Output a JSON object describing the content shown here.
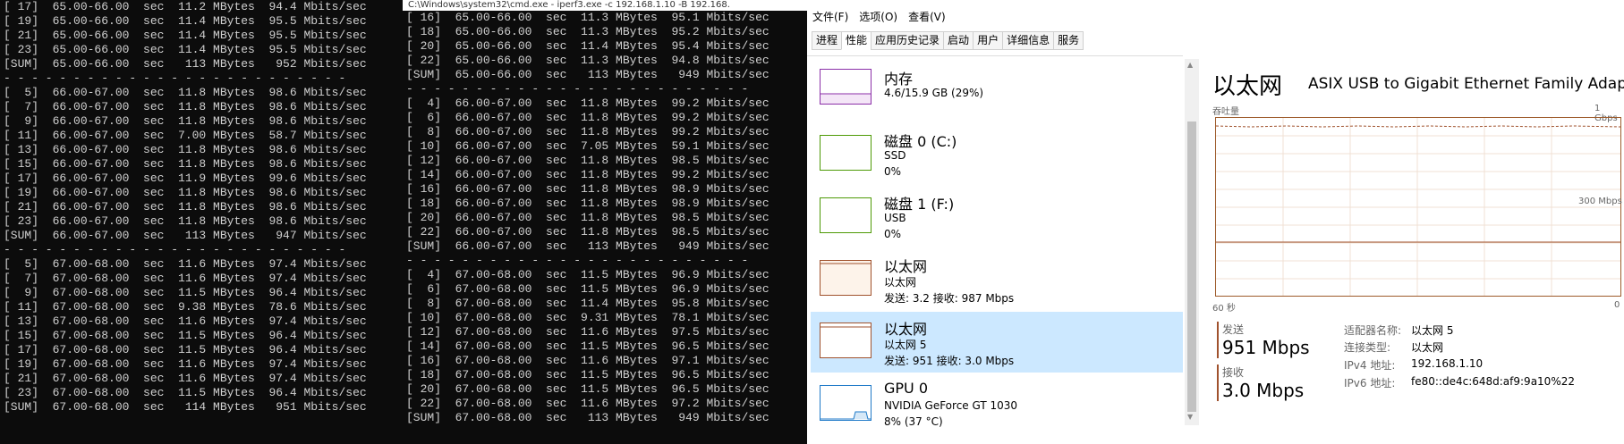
{
  "cmd1": {
    "lines": [
      "[ 17]  65.00-66.00  sec  11.2 MBytes  94.4 Mbits/sec",
      "[ 19]  65.00-66.00  sec  11.4 MBytes  95.5 Mbits/sec",
      "[ 21]  65.00-66.00  sec  11.4 MBytes  95.5 Mbits/sec",
      "[ 23]  65.00-66.00  sec  11.4 MBytes  95.5 Mbits/sec",
      "[SUM]  65.00-66.00  sec   113 MBytes   952 Mbits/sec",
      "- - - - - - - - - - - - - - - - - - - - - - - - -",
      "[  5]  66.00-67.00  sec  11.8 MBytes  98.6 Mbits/sec",
      "[  7]  66.00-67.00  sec  11.8 MBytes  98.6 Mbits/sec",
      "[  9]  66.00-67.00  sec  11.8 MBytes  98.6 Mbits/sec",
      "[ 11]  66.00-67.00  sec  7.00 MBytes  58.7 Mbits/sec",
      "[ 13]  66.00-67.00  sec  11.8 MBytes  98.6 Mbits/sec",
      "[ 15]  66.00-67.00  sec  11.8 MBytes  98.6 Mbits/sec",
      "[ 17]  66.00-67.00  sec  11.9 MBytes  99.6 Mbits/sec",
      "[ 19]  66.00-67.00  sec  11.8 MBytes  98.6 Mbits/sec",
      "[ 21]  66.00-67.00  sec  11.8 MBytes  98.6 Mbits/sec",
      "[ 23]  66.00-67.00  sec  11.8 MBytes  98.6 Mbits/sec",
      "[SUM]  66.00-67.00  sec   113 MBytes   947 Mbits/sec",
      "- - - - - - - - - - - - - - - - - - - - - - - - -",
      "[  5]  67.00-68.00  sec  11.6 MBytes  97.4 Mbits/sec",
      "[  7]  67.00-68.00  sec  11.6 MBytes  97.4 Mbits/sec",
      "[  9]  67.00-68.00  sec  11.5 MBytes  96.4 Mbits/sec",
      "[ 11]  67.00-68.00  sec  9.38 MBytes  78.6 Mbits/sec",
      "[ 13]  67.00-68.00  sec  11.6 MBytes  97.4 Mbits/sec",
      "[ 15]  67.00-68.00  sec  11.5 MBytes  96.4 Mbits/sec",
      "[ 17]  67.00-68.00  sec  11.5 MBytes  96.4 Mbits/sec",
      "[ 19]  67.00-68.00  sec  11.6 MBytes  97.4 Mbits/sec",
      "[ 21]  67.00-68.00  sec  11.6 MBytes  97.4 Mbits/sec",
      "[ 23]  67.00-68.00  sec  11.5 MBytes  96.4 Mbits/sec",
      "[SUM]  67.00-68.00  sec   114 MBytes   951 Mbits/sec"
    ]
  },
  "cmd2": {
    "title": "C:\\Windows\\system32\\cmd.exe - iperf3.exe  -c 192.168.1.10 -B 192.168.",
    "lines": [
      "[ 16]  65.00-66.00  sec  11.3 MBytes  95.1 Mbits/sec",
      "[ 18]  65.00-66.00  sec  11.3 MBytes  95.2 Mbits/sec",
      "[ 20]  65.00-66.00  sec  11.4 MBytes  95.4 Mbits/sec",
      "[ 22]  65.00-66.00  sec  11.3 MBytes  94.8 Mbits/sec",
      "[SUM]  65.00-66.00  sec   113 MBytes   949 Mbits/sec",
      "- - - - - - - - - - - - - - - - - - - - - - - - -",
      "[  4]  66.00-67.00  sec  11.8 MBytes  99.2 Mbits/sec",
      "[  6]  66.00-67.00  sec  11.8 MBytes  99.2 Mbits/sec",
      "[  8]  66.00-67.00  sec  11.8 MBytes  99.2 Mbits/sec",
      "[ 10]  66.00-67.00  sec  7.05 MBytes  59.1 Mbits/sec",
      "[ 12]  66.00-67.00  sec  11.8 MBytes  98.5 Mbits/sec",
      "[ 14]  66.00-67.00  sec  11.8 MBytes  99.2 Mbits/sec",
      "[ 16]  66.00-67.00  sec  11.8 MBytes  98.9 Mbits/sec",
      "[ 18]  66.00-67.00  sec  11.8 MBytes  98.9 Mbits/sec",
      "[ 20]  66.00-67.00  sec  11.8 MBytes  98.5 Mbits/sec",
      "[ 22]  66.00-67.00  sec  11.8 MBytes  98.5 Mbits/sec",
      "[SUM]  66.00-67.00  sec   113 MBytes   949 Mbits/sec",
      "- - - - - - - - - - - - - - - - - - - - - - - - -",
      "[  4]  67.00-68.00  sec  11.5 MBytes  96.9 Mbits/sec",
      "[  6]  67.00-68.00  sec  11.5 MBytes  96.9 Mbits/sec",
      "[  8]  67.00-68.00  sec  11.4 MBytes  95.8 Mbits/sec",
      "[ 10]  67.00-68.00  sec  9.31 MBytes  78.1 Mbits/sec",
      "[ 12]  67.00-68.00  sec  11.6 MBytes  97.5 Mbits/sec",
      "[ 14]  67.00-68.00  sec  11.5 MBytes  96.5 Mbits/sec",
      "[ 16]  67.00-68.00  sec  11.6 MBytes  97.1 Mbits/sec",
      "[ 18]  67.00-68.00  sec  11.5 MBytes  96.5 Mbits/sec",
      "[ 20]  67.00-68.00  sec  11.5 MBytes  96.5 Mbits/sec",
      "[ 22]  67.00-68.00  sec  11.6 MBytes  97.2 Mbits/sec",
      "[SUM]  67.00-68.00  sec   113 MBytes   949 Mbits/sec"
    ]
  },
  "taskmgr": {
    "menu": [
      "文件(F)",
      "选项(O)",
      "查看(V)"
    ],
    "tabs": [
      "进程",
      "性能",
      "应用历史记录",
      "启动",
      "用户",
      "详细信息",
      "服务"
    ],
    "active_tab": 1,
    "items": [
      {
        "name": "内存",
        "sub": "4.6/15.9 GB (29%)",
        "val": "",
        "color": "#8b2fa8"
      },
      {
        "name": "磁盘 0 (C:)",
        "sub": "SSD",
        "val": "0%",
        "color": "#4e9a06"
      },
      {
        "name": "磁盘 1 (F:)",
        "sub": "USB",
        "val": "0%",
        "color": "#4e9a06"
      },
      {
        "name": "以太网",
        "sub": "以太网",
        "val": "发送: 3.2  接收: 987 Mbps",
        "color": "#a0522d"
      },
      {
        "name": "以太网",
        "sub": "以太网 5",
        "val": "发送: 951  接收: 3.0 Mbps",
        "color": "#a0522d"
      },
      {
        "name": "GPU 0",
        "sub": "NVIDIA GeForce GT 1030",
        "val": "8% (37 °C)",
        "color": "#1f7ac8"
      }
    ],
    "selected_item": 4,
    "detail": {
      "title": "以太网",
      "adapter": "ASIX USB to Gigabit Ethernet Family Adapt...",
      "graph_label": "吞吐量",
      "graph_max": "1 Gbps",
      "graph_mid": "300 Mbps",
      "time_left": "60 秒",
      "time_right": "0",
      "send_label": "发送",
      "send_value": "951 Mbps",
      "recv_label": "接收",
      "recv_value": "3.0 Mbps",
      "props": [
        {
          "k": "适配器名称:",
          "v": "以太网 5"
        },
        {
          "k": "连接类型:",
          "v": "以太网"
        },
        {
          "k": "IPv4 地址:",
          "v": "192.168.1.10"
        },
        {
          "k": "IPv6 地址:",
          "v": "fe80::de4c:648d:af9:9a10%22"
        }
      ]
    }
  }
}
